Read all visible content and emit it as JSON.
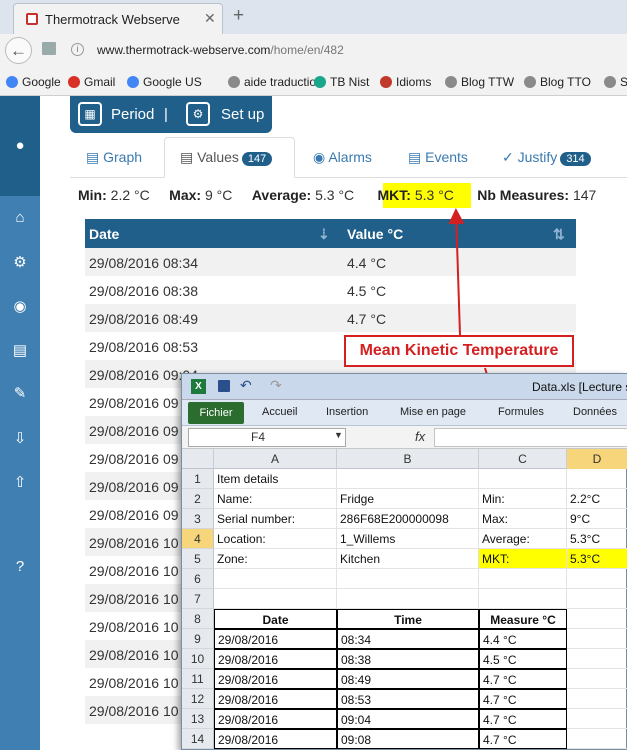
{
  "browser": {
    "tab_title": "Thermotrack Webserve",
    "tab_close": "✕",
    "new_tab": "+",
    "url_domain": "www.thermotrack-webserve.com",
    "url_path": "/home/en/482",
    "bookmarks": [
      {
        "label": "Google",
        "color": "#4285f4"
      },
      {
        "label": "Gmail",
        "color": "#d93025"
      },
      {
        "label": "Google US",
        "color": "#4285f4"
      },
      {
        "label": "aide traduction",
        "color": "#8a8a8a"
      },
      {
        "label": "TB Nist",
        "color": "#1aa68a"
      },
      {
        "label": "Idioms",
        "color": "#c0392b"
      },
      {
        "label": "Blog TTW",
        "color": "#8a8a8a"
      },
      {
        "label": "Blog TTO",
        "color": "#8a8a8a"
      },
      {
        "label": "S",
        "color": "#8a8a8a"
      }
    ]
  },
  "toolbar": {
    "period": "Period",
    "sep": "|",
    "setup": "Set up"
  },
  "tabs": {
    "graph": "Graph",
    "values": "Values",
    "values_count": "147",
    "alarms": "Alarms",
    "events": "Events",
    "justify": "Justify",
    "justify_count": "314"
  },
  "stats": {
    "min_label": "Min:",
    "min_value": "2.2 °C",
    "max_label": "Max:",
    "max_value": "9 °C",
    "avg_label": "Average:",
    "avg_value": "5.3 °C",
    "mkt_label": "MKT:",
    "mkt_value": "5.3 °C",
    "nb_label": "Nb Measures:",
    "nb_value": "147"
  },
  "grid": {
    "col_date": "Date",
    "col_value": "Value °C",
    "rows": [
      {
        "date": "29/08/2016 08:34",
        "value": "4.4 °C"
      },
      {
        "date": "29/08/2016 08:38",
        "value": "4.5 °C"
      },
      {
        "date": "29/08/2016 08:49",
        "value": "4.7 °C"
      },
      {
        "date": "29/08/2016 08:53",
        "value": ""
      },
      {
        "date": "29/08/2016 09:04",
        "value": ""
      },
      {
        "date": "29/08/2016 09",
        "value": ""
      },
      {
        "date": "29/08/2016 09",
        "value": ""
      },
      {
        "date": "29/08/2016 09",
        "value": ""
      },
      {
        "date": "29/08/2016 09",
        "value": ""
      },
      {
        "date": "29/08/2016 09",
        "value": ""
      },
      {
        "date": "29/08/2016 10",
        "value": ""
      },
      {
        "date": "29/08/2016 10",
        "value": ""
      },
      {
        "date": "29/08/2016 10",
        "value": ""
      },
      {
        "date": "29/08/2016 10",
        "value": ""
      },
      {
        "date": "29/08/2016 10",
        "value": ""
      },
      {
        "date": "29/08/2016 10",
        "value": ""
      },
      {
        "date": "29/08/2016 10",
        "value": ""
      }
    ]
  },
  "annotation": {
    "label": "Mean Kinetic Temperature",
    "color": "#d42020"
  },
  "excel": {
    "title": "Data.xls  [Lecture s",
    "ribbon": [
      "Fichier",
      "Accueil",
      "Insertion",
      "Mise en page",
      "Formules",
      "Données"
    ],
    "namebox": "F4",
    "fx": "fx",
    "columns": [
      "A",
      "B",
      "C",
      "D"
    ],
    "rows": [
      {
        "n": "1",
        "a": "Item details",
        "b": "",
        "c": "",
        "d": ""
      },
      {
        "n": "2",
        "a": "Name:",
        "b": "Fridge",
        "c": "Min:",
        "d": "2.2°C"
      },
      {
        "n": "3",
        "a": "Serial number:",
        "b": "286F68E200000098",
        "c": "Max:",
        "d": "9°C"
      },
      {
        "n": "4",
        "a": "Location:",
        "b": "1_Willems",
        "c": "Average:",
        "d": "5.3°C"
      },
      {
        "n": "5",
        "a": "Zone:",
        "b": "Kitchen",
        "c": "MKT:",
        "d": "5.3°C"
      },
      {
        "n": "6",
        "a": "",
        "b": "",
        "c": "",
        "d": ""
      },
      {
        "n": "7",
        "a": "",
        "b": "",
        "c": "",
        "d": ""
      },
      {
        "n": "8",
        "a": "Date",
        "b": "Time",
        "c": "Measure °C",
        "d": ""
      },
      {
        "n": "9",
        "a": "29/08/2016",
        "b": "08:34",
        "c": "4.4 °C",
        "d": ""
      },
      {
        "n": "10",
        "a": "29/08/2016",
        "b": "08:38",
        "c": "4.5 °C",
        "d": ""
      },
      {
        "n": "11",
        "a": "29/08/2016",
        "b": "08:49",
        "c": "4.7 °C",
        "d": ""
      },
      {
        "n": "12",
        "a": "29/08/2016",
        "b": "08:53",
        "c": "4.7 °C",
        "d": ""
      },
      {
        "n": "13",
        "a": "29/08/2016",
        "b": "09:04",
        "c": "4.7 °C",
        "d": ""
      },
      {
        "n": "14",
        "a": "29/08/2016",
        "b": "09:08",
        "c": "4.7 °C",
        "d": ""
      }
    ]
  }
}
